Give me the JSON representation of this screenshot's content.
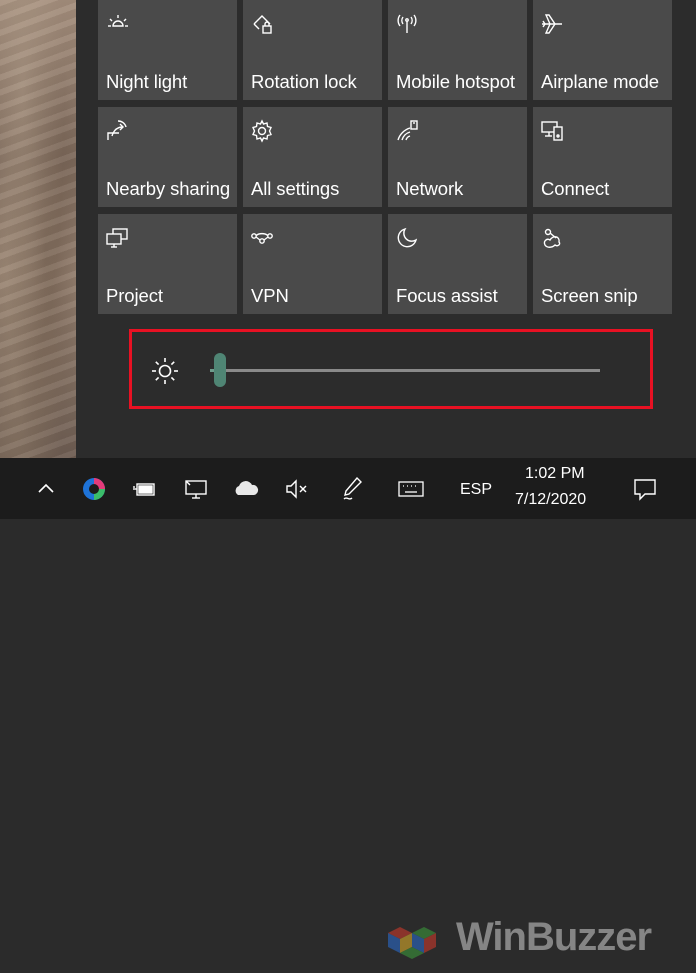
{
  "tiles": [
    {
      "label": "Night light",
      "icon": "night-light-icon"
    },
    {
      "label": "Rotation lock",
      "icon": "rotation-lock-icon"
    },
    {
      "label": "Mobile hotspot",
      "icon": "mobile-hotspot-icon"
    },
    {
      "label": "Airplane mode",
      "icon": "airplane-icon"
    },
    {
      "label": "Nearby sharing",
      "icon": "nearby-sharing-icon"
    },
    {
      "label": "All settings",
      "icon": "gear-icon"
    },
    {
      "label": "Network",
      "icon": "network-icon"
    },
    {
      "label": "Connect",
      "icon": "connect-icon"
    },
    {
      "label": "Project",
      "icon": "project-icon"
    },
    {
      "label": "VPN",
      "icon": "vpn-icon"
    },
    {
      "label": "Focus assist",
      "icon": "moon-icon"
    },
    {
      "label": "Screen snip",
      "icon": "screen-snip-icon"
    }
  ],
  "brightness": {
    "level": 0.01,
    "icon": "sun-icon",
    "highlight_color": "#e81123",
    "thumb_color": "#4f8574"
  },
  "taskbar": {
    "icons": [
      "chevron-up-icon",
      "browser-icon",
      "battery-icon",
      "network-icon",
      "cloud-icon",
      "volume-muted-icon",
      "pen-icon",
      "keyboard-icon"
    ],
    "language": "ESP",
    "time": "1:02 PM",
    "date": "7/12/2020",
    "notification_icon": "notification-icon"
  },
  "watermark": {
    "text": "WinBuzzer"
  },
  "colors": {
    "panel": "#2c2c2c",
    "tile": "#4a4a4a",
    "taskbar": "#1c1c1c"
  }
}
